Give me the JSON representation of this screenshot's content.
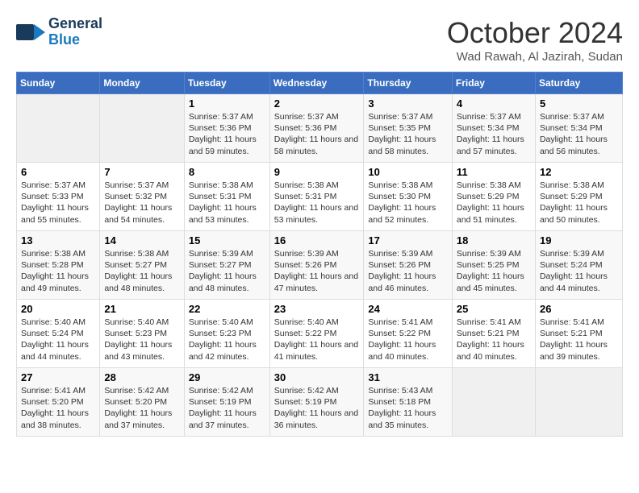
{
  "header": {
    "logo_general": "General",
    "logo_blue": "Blue",
    "month": "October 2024",
    "location": "Wad Rawah, Al Jazirah, Sudan"
  },
  "weekdays": [
    "Sunday",
    "Monday",
    "Tuesday",
    "Wednesday",
    "Thursday",
    "Friday",
    "Saturday"
  ],
  "weeks": [
    [
      {
        "day": "",
        "empty": true
      },
      {
        "day": "",
        "empty": true
      },
      {
        "day": "1",
        "sunrise": "Sunrise: 5:37 AM",
        "sunset": "Sunset: 5:36 PM",
        "daylight": "Daylight: 11 hours and 59 minutes."
      },
      {
        "day": "2",
        "sunrise": "Sunrise: 5:37 AM",
        "sunset": "Sunset: 5:36 PM",
        "daylight": "Daylight: 11 hours and 58 minutes."
      },
      {
        "day": "3",
        "sunrise": "Sunrise: 5:37 AM",
        "sunset": "Sunset: 5:35 PM",
        "daylight": "Daylight: 11 hours and 58 minutes."
      },
      {
        "day": "4",
        "sunrise": "Sunrise: 5:37 AM",
        "sunset": "Sunset: 5:34 PM",
        "daylight": "Daylight: 11 hours and 57 minutes."
      },
      {
        "day": "5",
        "sunrise": "Sunrise: 5:37 AM",
        "sunset": "Sunset: 5:34 PM",
        "daylight": "Daylight: 11 hours and 56 minutes."
      }
    ],
    [
      {
        "day": "6",
        "sunrise": "Sunrise: 5:37 AM",
        "sunset": "Sunset: 5:33 PM",
        "daylight": "Daylight: 11 hours and 55 minutes."
      },
      {
        "day": "7",
        "sunrise": "Sunrise: 5:37 AM",
        "sunset": "Sunset: 5:32 PM",
        "daylight": "Daylight: 11 hours and 54 minutes."
      },
      {
        "day": "8",
        "sunrise": "Sunrise: 5:38 AM",
        "sunset": "Sunset: 5:31 PM",
        "daylight": "Daylight: 11 hours and 53 minutes."
      },
      {
        "day": "9",
        "sunrise": "Sunrise: 5:38 AM",
        "sunset": "Sunset: 5:31 PM",
        "daylight": "Daylight: 11 hours and 53 minutes."
      },
      {
        "day": "10",
        "sunrise": "Sunrise: 5:38 AM",
        "sunset": "Sunset: 5:30 PM",
        "daylight": "Daylight: 11 hours and 52 minutes."
      },
      {
        "day": "11",
        "sunrise": "Sunrise: 5:38 AM",
        "sunset": "Sunset: 5:29 PM",
        "daylight": "Daylight: 11 hours and 51 minutes."
      },
      {
        "day": "12",
        "sunrise": "Sunrise: 5:38 AM",
        "sunset": "Sunset: 5:29 PM",
        "daylight": "Daylight: 11 hours and 50 minutes."
      }
    ],
    [
      {
        "day": "13",
        "sunrise": "Sunrise: 5:38 AM",
        "sunset": "Sunset: 5:28 PM",
        "daylight": "Daylight: 11 hours and 49 minutes."
      },
      {
        "day": "14",
        "sunrise": "Sunrise: 5:38 AM",
        "sunset": "Sunset: 5:27 PM",
        "daylight": "Daylight: 11 hours and 48 minutes."
      },
      {
        "day": "15",
        "sunrise": "Sunrise: 5:39 AM",
        "sunset": "Sunset: 5:27 PM",
        "daylight": "Daylight: 11 hours and 48 minutes."
      },
      {
        "day": "16",
        "sunrise": "Sunrise: 5:39 AM",
        "sunset": "Sunset: 5:26 PM",
        "daylight": "Daylight: 11 hours and 47 minutes."
      },
      {
        "day": "17",
        "sunrise": "Sunrise: 5:39 AM",
        "sunset": "Sunset: 5:26 PM",
        "daylight": "Daylight: 11 hours and 46 minutes."
      },
      {
        "day": "18",
        "sunrise": "Sunrise: 5:39 AM",
        "sunset": "Sunset: 5:25 PM",
        "daylight": "Daylight: 11 hours and 45 minutes."
      },
      {
        "day": "19",
        "sunrise": "Sunrise: 5:39 AM",
        "sunset": "Sunset: 5:24 PM",
        "daylight": "Daylight: 11 hours and 44 minutes."
      }
    ],
    [
      {
        "day": "20",
        "sunrise": "Sunrise: 5:40 AM",
        "sunset": "Sunset: 5:24 PM",
        "daylight": "Daylight: 11 hours and 44 minutes."
      },
      {
        "day": "21",
        "sunrise": "Sunrise: 5:40 AM",
        "sunset": "Sunset: 5:23 PM",
        "daylight": "Daylight: 11 hours and 43 minutes."
      },
      {
        "day": "22",
        "sunrise": "Sunrise: 5:40 AM",
        "sunset": "Sunset: 5:23 PM",
        "daylight": "Daylight: 11 hours and 42 minutes."
      },
      {
        "day": "23",
        "sunrise": "Sunrise: 5:40 AM",
        "sunset": "Sunset: 5:22 PM",
        "daylight": "Daylight: 11 hours and 41 minutes."
      },
      {
        "day": "24",
        "sunrise": "Sunrise: 5:41 AM",
        "sunset": "Sunset: 5:22 PM",
        "daylight": "Daylight: 11 hours and 40 minutes."
      },
      {
        "day": "25",
        "sunrise": "Sunrise: 5:41 AM",
        "sunset": "Sunset: 5:21 PM",
        "daylight": "Daylight: 11 hours and 40 minutes."
      },
      {
        "day": "26",
        "sunrise": "Sunrise: 5:41 AM",
        "sunset": "Sunset: 5:21 PM",
        "daylight": "Daylight: 11 hours and 39 minutes."
      }
    ],
    [
      {
        "day": "27",
        "sunrise": "Sunrise: 5:41 AM",
        "sunset": "Sunset: 5:20 PM",
        "daylight": "Daylight: 11 hours and 38 minutes."
      },
      {
        "day": "28",
        "sunrise": "Sunrise: 5:42 AM",
        "sunset": "Sunset: 5:20 PM",
        "daylight": "Daylight: 11 hours and 37 minutes."
      },
      {
        "day": "29",
        "sunrise": "Sunrise: 5:42 AM",
        "sunset": "Sunset: 5:19 PM",
        "daylight": "Daylight: 11 hours and 37 minutes."
      },
      {
        "day": "30",
        "sunrise": "Sunrise: 5:42 AM",
        "sunset": "Sunset: 5:19 PM",
        "daylight": "Daylight: 11 hours and 36 minutes."
      },
      {
        "day": "31",
        "sunrise": "Sunrise: 5:43 AM",
        "sunset": "Sunset: 5:18 PM",
        "daylight": "Daylight: 11 hours and 35 minutes."
      },
      {
        "day": "",
        "empty": true
      },
      {
        "day": "",
        "empty": true
      }
    ]
  ]
}
